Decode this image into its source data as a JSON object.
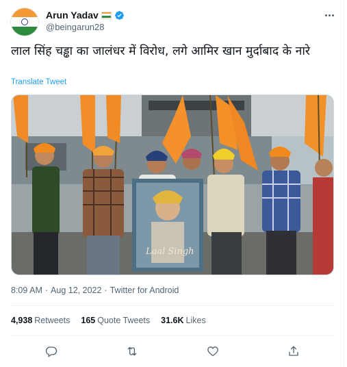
{
  "author": {
    "display_name": "Arun Yadav",
    "handle": "@beingarun28",
    "verified": true,
    "name_emoji": "indian-flag"
  },
  "tweet": {
    "text": "लाल सिंह चड्ढा का जालंधर में विरोध, लगे आमिर खान मुर्दाबाद के नारे",
    "translate_label": "Translate Tweet",
    "time": "8:09 AM",
    "date": "Aug 12, 2022",
    "separator": "·",
    "source": "Twitter for Android"
  },
  "stats": {
    "retweets_count": "4,938",
    "retweets_label": "Retweets",
    "quotes_count": "165",
    "quotes_label": "Quote Tweets",
    "likes_count": "31.6K",
    "likes_label": "Likes"
  },
  "actions": [
    "reply-icon",
    "retweet-icon",
    "like-icon",
    "share-icon"
  ],
  "colors": {
    "accent": "#1d9bf0",
    "text_primary": "#0f1419",
    "text_secondary": "#536471",
    "verified": "#1d9bf0"
  }
}
